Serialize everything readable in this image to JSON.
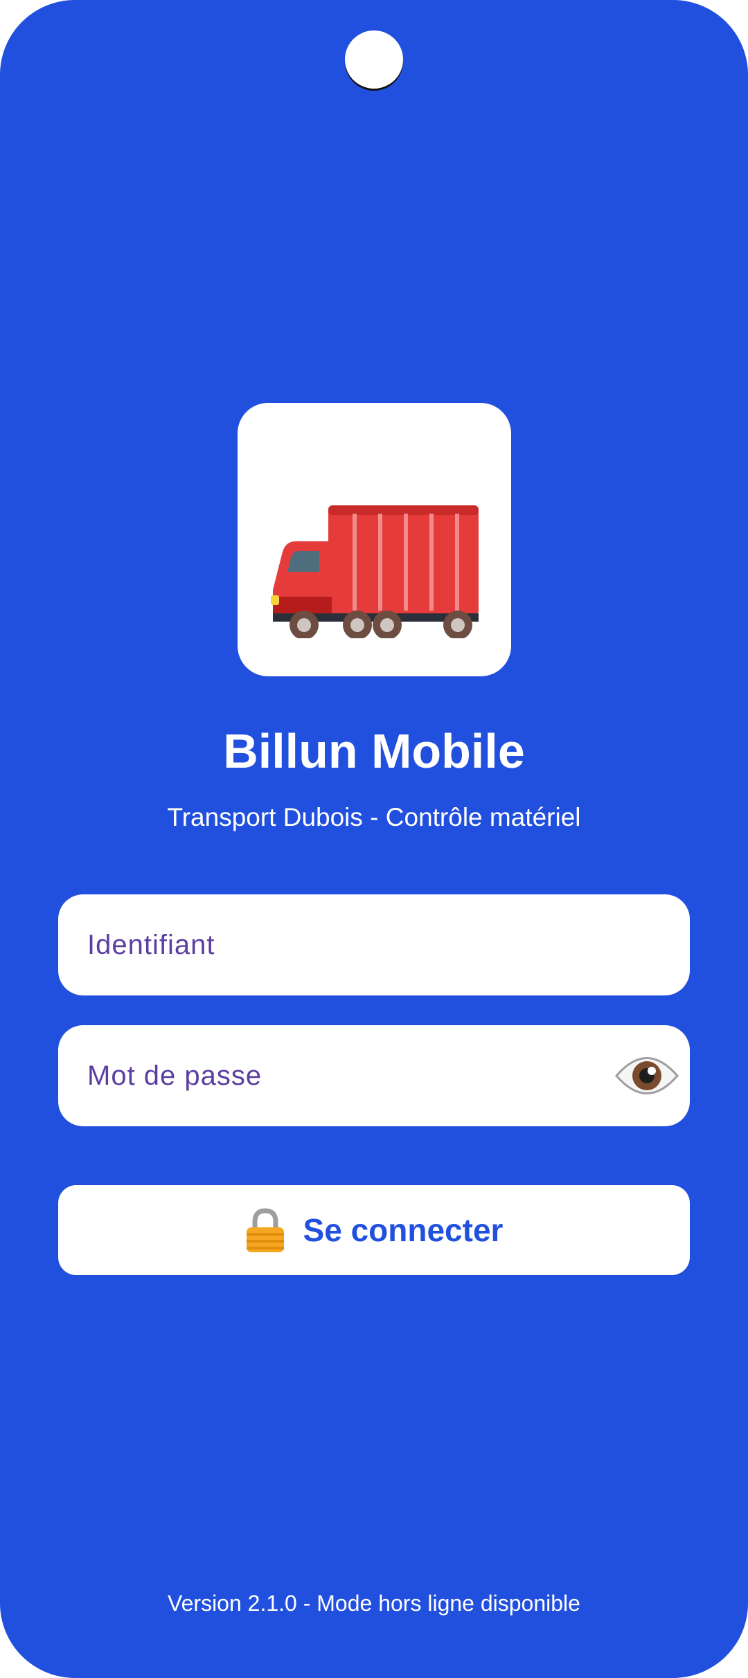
{
  "app": {
    "title": "Billun Mobile",
    "subtitle": "Transport Dubois - Contrôle matériel",
    "logo_icon": "truck-icon"
  },
  "form": {
    "username_placeholder": "Identifiant",
    "username_value": "",
    "password_placeholder": "Mot de passe",
    "password_value": "",
    "show_password_icon": "eye-icon",
    "login_icon": "lock-icon",
    "login_label": "Se connecter"
  },
  "footer": {
    "version": "Version 2.1.0 - Mode hors ligne disponible"
  },
  "colors": {
    "background": "#2250DE",
    "surface": "#FFFFFF",
    "placeholder": "#5B3FA0",
    "button_text": "#2250DE"
  }
}
